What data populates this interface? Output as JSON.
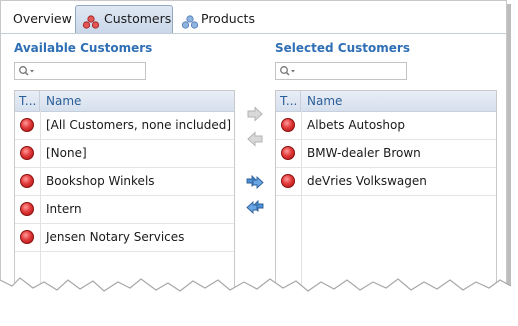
{
  "tabs": [
    {
      "label": "Overview",
      "active": false
    },
    {
      "label": "Customers",
      "active": true
    },
    {
      "label": "Products",
      "active": false
    }
  ],
  "available": {
    "title": "Available Customers",
    "filter_value": "",
    "columns": {
      "type": "T...",
      "name": "Name"
    },
    "rows": [
      {
        "name": "[All Customers, none included]",
        "status_icon": "red-status-icon"
      },
      {
        "name": "[None]",
        "status_icon": "red-status-icon"
      },
      {
        "name": "Bookshop Winkels",
        "status_icon": "red-status-icon"
      },
      {
        "name": "Intern",
        "status_icon": "red-status-icon"
      },
      {
        "name": "Jensen Notary Services",
        "status_icon": "red-status-icon"
      }
    ]
  },
  "selected": {
    "title": "Selected Customers",
    "filter_value": "",
    "columns": {
      "type": "T...",
      "name": "Name"
    },
    "rows": [
      {
        "name": "Albets Autoshop",
        "status_icon": "red-status-icon"
      },
      {
        "name": "BMW-dealer Brown",
        "status_icon": "red-status-icon"
      },
      {
        "name": "deVries Volkswagen",
        "status_icon": "red-status-icon"
      }
    ]
  },
  "buttons": [
    {
      "name": "move-right-button",
      "icon": "arrow-right-icon",
      "enabled": false
    },
    {
      "name": "move-left-button",
      "icon": "arrow-left-icon",
      "enabled": false
    },
    {
      "name": "move-all-right-button",
      "icon": "double-arrow-right-icon",
      "enabled": true
    },
    {
      "name": "move-all-left-button",
      "icon": "double-arrow-left-icon",
      "enabled": true
    }
  ],
  "colors": {
    "section_title": "#2f6fb5",
    "header_text": "#2b5e98",
    "status_red": "#e23a3a"
  }
}
